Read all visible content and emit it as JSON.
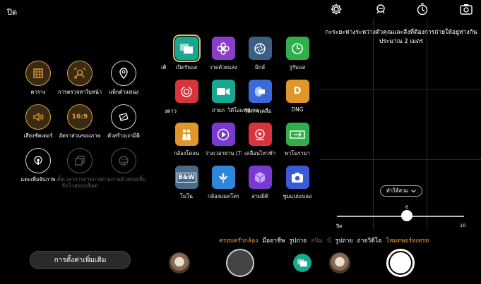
{
  "close_label": "ปิด",
  "left_options": [
    {
      "label": "ตาราง",
      "state": "on",
      "icon": "grid-icon"
    },
    {
      "label": "การตรวจหาใบหน้า",
      "state": "on",
      "icon": "face-detect-icon"
    },
    {
      "label": "แท็กตำแหน่ง",
      "state": "off",
      "icon": "location-pin-icon"
    },
    {
      "label": "เสียงชัตเตอร์",
      "state": "on",
      "icon": "speaker-icon"
    },
    {
      "label": "อัตราส่วนของภาพ",
      "state": "on",
      "icon_text": "16:9",
      "icon": "aspect-ratio-icon"
    },
    {
      "label": "ตัวสร้างเงามิติ",
      "state": "off",
      "icon": "shadow-creator-icon"
    },
    {
      "label": "แตะเพื่อจับภาพ",
      "state": "off",
      "icon": "tap-capture-icon"
    },
    {
      "label": "ตั้งเวลาการถ่ายภาพ จับโวสแบบช็อต",
      "state": "dim",
      "icon": "timer-copy-icon"
    },
    {
      "label": "ถ่ายภาพด้วยรอยยิ้ม",
      "state": "dim",
      "icon": "smile-icon"
    }
  ],
  "more_settings_label": "การตั้งค่าเพิ่มเติม",
  "mode_tiles": [
    {
      "label": "เปิดรับแส",
      "color": "#17a98f",
      "icon": "long-exposure-icon",
      "selected": true
    },
    {
      "label": "วาดด้วยแสง",
      "color": "#8a3ec8",
      "icon": "light-painting-icon"
    },
    {
      "label": "มิกส์",
      "color": "#3b5f82",
      "icon": "aperture-icon"
    },
    {
      "label": "รูรับแส",
      "color": "#2fae4a",
      "icon": "clock-icon"
    },
    {
      "label": "งดาว",
      "color": "#d8343e",
      "icon": "star-trail-icon"
    },
    {
      "label": "ถ่ายภ",
      "color": "#17a98f",
      "icon": "video-icon"
    },
    {
      "label": "วิดีโอแพนเกอร์",
      "color": "#3b6ad8",
      "icon": "film-roll-icon"
    },
    {
      "label": "วิถีการเคลื่อ",
      "color": "#e0962a",
      "icon_text": "D",
      "icon": "dng-icon"
    },
    {
      "label": "DNG",
      "color": "",
      "icon": ""
    },
    {
      "label": "กล้องโคลน",
      "color": "#e0962a",
      "icon": "clone-people-icon"
    },
    {
      "label": "ว่างเวลาผ่าน (Tim",
      "color": "#7a3ad0",
      "icon": "play-icon"
    },
    {
      "label": "เคลื่อนไหวช้า",
      "color": "#d8343e",
      "icon": "slow-motion-icon"
    },
    {
      "label": "พาโนรามา",
      "color": "#2fae4a",
      "icon": "panorama-icon"
    },
    {
      "label": "โมโน",
      "color": "#4a6a8a",
      "icon_text": "B&W",
      "icon": "bw-icon"
    },
    {
      "label": "กล้องแมคโคร",
      "color": "#2f86d8",
      "icon": "flower-icon"
    },
    {
      "label": "สามมิติ",
      "color": "#7a3ad0",
      "icon": "cube-icon"
    },
    {
      "label": "ซูมแบบเบลอ",
      "color": "#3a5ad8",
      "icon": "camera-zoom-icon"
    }
  ],
  "left_col_labels": [
    "เติ",
    "งดาว",
    "กล้องโคลน",
    "โมโน"
  ],
  "hint_text": "กะระยะห่างระหว่างตัวคุณและสิ่งที่ต้องการถ่ายให้อยู่ห่างกันประมาณ 2 เมตร",
  "frame_dropdown": "ทำให้สวม",
  "slider": {
    "value": "6",
    "min_label": "ปิด",
    "max_label": "10",
    "fraction": 0.55
  },
  "mode_strip": [
    {
      "label": "ครอบครัวกล้อง",
      "style": "orange"
    },
    {
      "label": "มืออาชีพ",
      "style": "normal"
    },
    {
      "label": "รูปถ่าย",
      "style": "normal"
    },
    {
      "label": "สนิม",
      "style": "dim"
    },
    {
      "label": "นั่",
      "style": "dim"
    },
    {
      "label": "รูปถ่าย",
      "style": "normal"
    },
    {
      "label": "ถ่ายวิดีโอ",
      "style": "normal"
    },
    {
      "label": "โหมดพอร์ทเทรท",
      "style": "orange"
    }
  ],
  "top_icons": [
    "settings-gear-icon",
    "ai-scene-icon",
    "timer-icon",
    "switch-camera-icon"
  ]
}
